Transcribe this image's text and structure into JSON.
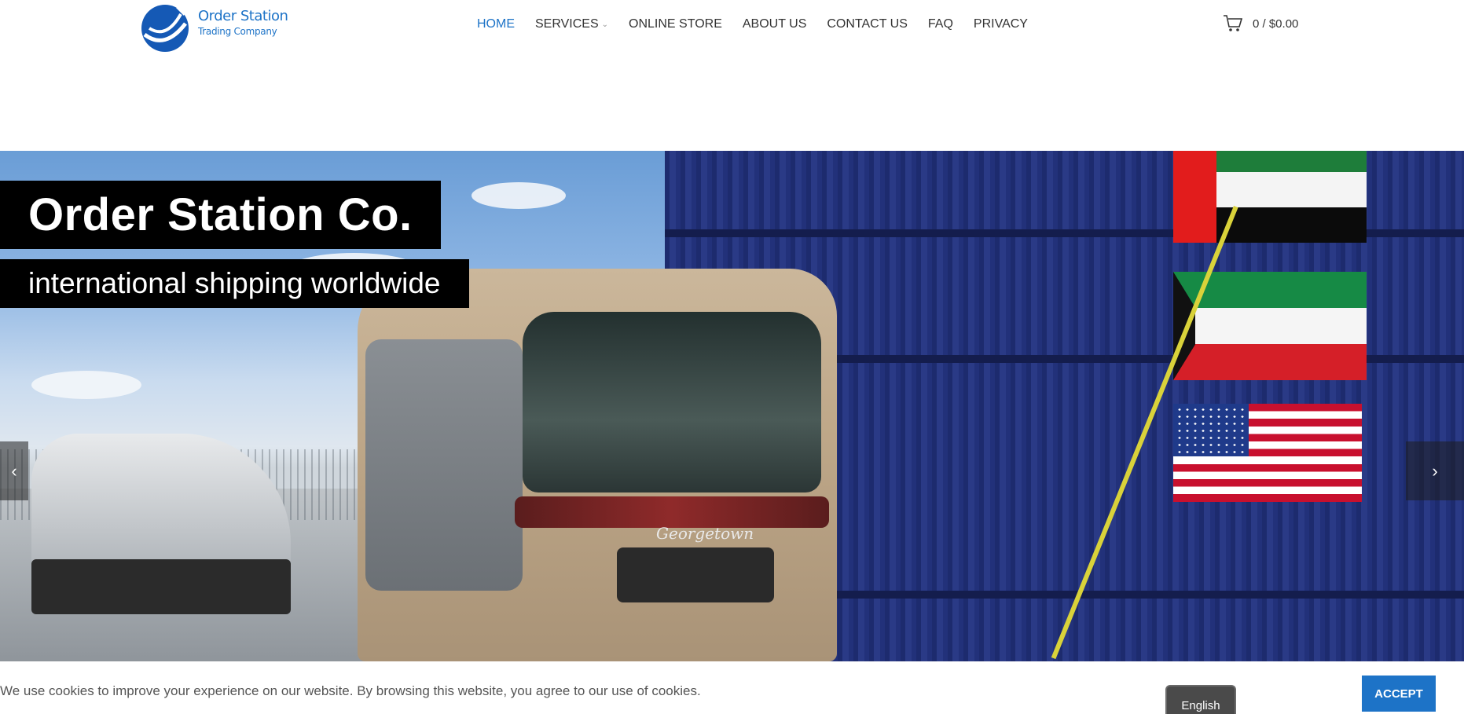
{
  "header": {
    "logo": {
      "name": "Order Station",
      "subtitle": "Trading Company",
      "icon": "globe-arrow-logo"
    },
    "nav": [
      {
        "label": "HOME",
        "active": true
      },
      {
        "label": "SERVICES",
        "has_dropdown": true
      },
      {
        "label": "ONLINE STORE"
      },
      {
        "label": "ABOUT US"
      },
      {
        "label": "CONTACT US"
      },
      {
        "label": "FAQ"
      },
      {
        "label": "PRIVACY"
      }
    ],
    "cart": {
      "icon": "cart-icon",
      "label": "0 / $0.00"
    }
  },
  "hero": {
    "title": "Order Station Co.",
    "subtitle": "international shipping worldwide",
    "vehicle_brand": "Georgetown",
    "prev_icon": "chevron-left-icon",
    "next_icon": "chevron-right-icon"
  },
  "cookie_bar": {
    "message": "We use cookies to improve your experience on our website. By browsing this website, you agree to our use of cookies.",
    "accept_label": "ACCEPT",
    "language_label": "English"
  },
  "colors": {
    "accent": "#1d73c7",
    "nav_text": "#333333",
    "hero_label_bg": "#000000"
  }
}
